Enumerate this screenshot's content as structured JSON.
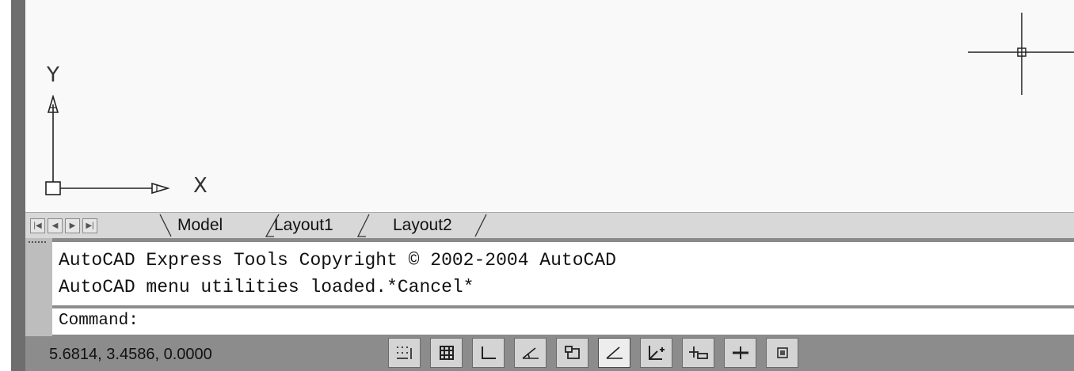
{
  "ucs": {
    "y_label": "Y",
    "x_label": "X"
  },
  "tabs": {
    "nav_buttons": [
      "first-tab",
      "previous-tab",
      "next-tab",
      "last-tab"
    ],
    "items": [
      {
        "label": "Model",
        "active": true
      },
      {
        "label": "Layout1",
        "active": false
      },
      {
        "label": "Layout2",
        "active": false
      }
    ]
  },
  "command_window": {
    "history": [
      "AutoCAD Express Tools Copyright © 2002-2004 AutoCAD",
      "AutoCAD menu utilities loaded.*Cancel*"
    ],
    "prompt": "Command:"
  },
  "status_bar": {
    "coordinates": "5.6814, 3.4586, 0.0000",
    "toggles": [
      {
        "name": "snap-mode",
        "icon": "snap-icon",
        "on": false
      },
      {
        "name": "grid-display",
        "icon": "grid-icon",
        "on": false
      },
      {
        "name": "ortho-mode",
        "icon": "ortho-icon",
        "on": false
      },
      {
        "name": "polar-tracking",
        "icon": "polar-icon",
        "on": false
      },
      {
        "name": "object-snap",
        "icon": "osnap-icon",
        "on": false
      },
      {
        "name": "object-snap-tracking",
        "icon": "otrack-icon",
        "on": true
      },
      {
        "name": "dynamic-ucs",
        "icon": "ducs-icon",
        "on": false
      },
      {
        "name": "dynamic-input",
        "icon": "dyn-icon",
        "on": false
      },
      {
        "name": "lineweight",
        "icon": "lineweight-icon",
        "on": false
      },
      {
        "name": "model-space",
        "icon": "model-icon",
        "on": false
      }
    ]
  }
}
